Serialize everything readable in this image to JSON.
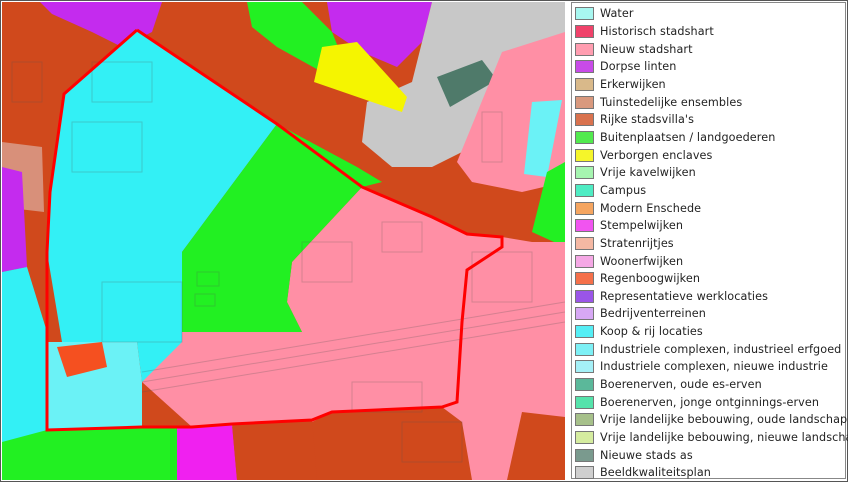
{
  "legend": {
    "items": [
      {
        "label": "Water",
        "color": "#a8f7f0"
      },
      {
        "label": "Historisch stadshart",
        "color": "#f0426a"
      },
      {
        "label": "Nieuw stadshart",
        "color": "#ff9db0"
      },
      {
        "label": "Dorpse linten",
        "color": "#c84be8"
      },
      {
        "label": "Erkerwijken",
        "color": "#d9b98a"
      },
      {
        "label": "Tuinstedelijke ensembles",
        "color": "#d9997e"
      },
      {
        "label": "Rijke stadsvilla's",
        "color": "#d9724e"
      },
      {
        "label": "Buitenplaatsen / landgoederen",
        "color": "#52ea4e"
      },
      {
        "label": "Verborgen enclaves",
        "color": "#f5f52a"
      },
      {
        "label": "Vrije kavelwijken",
        "color": "#a6f5b0"
      },
      {
        "label": "Campus",
        "color": "#4fecc3"
      },
      {
        "label": "Modern Enschede",
        "color": "#f5a560"
      },
      {
        "label": "Stempelwijken",
        "color": "#f154f0"
      },
      {
        "label": "Stratenrijtjes",
        "color": "#f5b8a3"
      },
      {
        "label": "Woonerfwijken",
        "color": "#f5a8e5"
      },
      {
        "label": "Regenboogwijken",
        "color": "#f5704a"
      },
      {
        "label": "Representatieve werklocaties",
        "color": "#9a55e8"
      },
      {
        "label": "Bedrijventerreinen",
        "color": "#d7a8f5"
      },
      {
        "label": "Koop & rij locaties",
        "color": "#55eef5"
      },
      {
        "label": "Industriele complexen, industrieel erfgoed",
        "color": "#7df0f5"
      },
      {
        "label": "Industriele complexen, nieuwe industrie",
        "color": "#a5f0f7"
      },
      {
        "label": "Boerenerven, oude es-erven",
        "color": "#5bb89a"
      },
      {
        "label": "Boerenerven, jonge ontginnings-erven",
        "color": "#55e3ab"
      },
      {
        "label": "Vrije landelijke bebouwing, oude landschap",
        "color": "#a6c08a"
      },
      {
        "label": "Vrije landelijke bebouwing, nieuwe landschap",
        "color": "#d5ec9f"
      },
      {
        "label": "Nieuwe stads as",
        "color": "#7a9a8e"
      },
      {
        "label": "Beeldkwaliteitsplan",
        "color": "#cfcfcf"
      }
    ]
  },
  "map": {
    "outline_color": "#ff0000",
    "zones": {
      "rich_villas": "#d0491c",
      "new_center": "#ff8fa5",
      "koop_rij": "#33f0f5",
      "industrial_heritage": "#6bf2f6",
      "estates": "#22f022",
      "hidden_enclaves": "#f5f500",
      "village_ribbons": "#c42bee",
      "stamp_districts": "#f020f0",
      "plan_area": "#c8c8c8",
      "new_city_axis": "#4f7a6a",
      "rainbow": "#f55020",
      "garden_ensembles": "#d8907a"
    }
  }
}
